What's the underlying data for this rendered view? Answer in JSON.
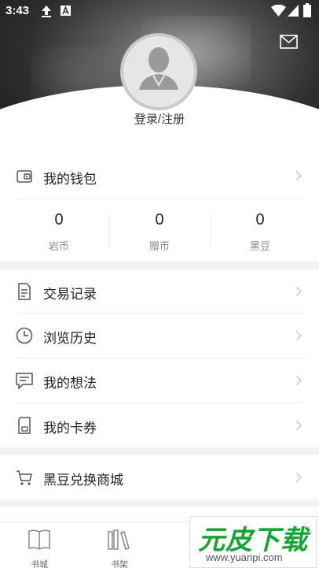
{
  "status_bar": {
    "time": "3:43"
  },
  "profile": {
    "login_label": "登录/注册"
  },
  "wallet": {
    "title": "我的钱包",
    "stats": [
      {
        "value": "0",
        "label": "岩币"
      },
      {
        "value": "0",
        "label": "赠币"
      },
      {
        "value": "0",
        "label": "黑豆"
      }
    ]
  },
  "menu": [
    {
      "label": "交易记录",
      "icon": "receipt-icon"
    },
    {
      "label": "浏览历史",
      "icon": "clock-icon"
    },
    {
      "label": "我的想法",
      "icon": "comment-icon"
    },
    {
      "label": "我的卡券",
      "icon": "card-icon"
    }
  ],
  "store": {
    "label": "黑豆兑换商城",
    "icon": "cart-icon"
  },
  "tabbar": {
    "items": [
      {
        "label": "书城"
      },
      {
        "label": "书架"
      }
    ]
  },
  "watermark": {
    "text": "元皮下载",
    "url": "www.yuanpi.com"
  }
}
